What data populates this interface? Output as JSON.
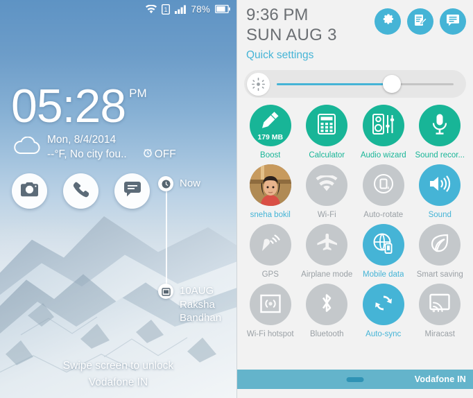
{
  "colors": {
    "accent_blue": "#45b4d6",
    "accent_green": "#18b597",
    "label_off": "#9aa0a5",
    "panel_bg": "#f2f2f2",
    "footer_bar": "#64b4cb",
    "header_text": "#6b6f73"
  },
  "lockscreen": {
    "statusbar": {
      "wifi_icon": "wifi-icon",
      "sim_icon": "sim1-icon",
      "signal_icon": "signal-bars-icon",
      "battery_percent": "78%",
      "battery_icon": "battery-icon"
    },
    "clock": {
      "time": "05:28",
      "ampm": "PM",
      "date": "Mon, 8/4/2014",
      "weather": "--°F, No city fou..",
      "alarm_status": "OFF",
      "weather_icon": "cloud-icon",
      "alarm_icon": "alarm-clock-icon"
    },
    "shortcuts": [
      {
        "name": "camera-shortcut",
        "icon": "camera-icon"
      },
      {
        "name": "phone-shortcut",
        "icon": "phone-icon"
      },
      {
        "name": "messaging-shortcut",
        "icon": "message-icon"
      }
    ],
    "timeline": [
      {
        "icon": "clock-icon",
        "label": "Now",
        "sub": ""
      },
      {
        "icon": "calendar-icon",
        "label": "10AUG",
        "sub": "Raksha\nBandhan",
        "sub_line1": "Raksha",
        "sub_line2": "Bandhan"
      }
    ],
    "unlock_hint": "Swipe screen to unlock",
    "carrier": "Vodafone IN"
  },
  "quicksettings": {
    "time": "9:36 PM",
    "date": "SUN AUG 3",
    "subtitle": "Quick settings",
    "header_buttons": [
      {
        "name": "settings-button",
        "icon": "gear-icon"
      },
      {
        "name": "edit-quick-settings-button",
        "icon": "edit-note-icon"
      },
      {
        "name": "notifications-button",
        "icon": "list-icon"
      }
    ],
    "brightness": {
      "icon": "brightness-sun-icon",
      "value_percent": 65
    },
    "tiles": [
      {
        "label": "Boost",
        "icon": "broom-icon",
        "state": "app",
        "badge": "179 MB"
      },
      {
        "label": "Calculator",
        "icon": "calculator-icon",
        "state": "app",
        "badge": ""
      },
      {
        "label": "Audio wizard",
        "icon": "audio-wizard-icon",
        "state": "app",
        "badge": ""
      },
      {
        "label": "Sound recor...",
        "icon": "microphone-icon",
        "state": "app",
        "badge": ""
      },
      {
        "label": "sneha bokil",
        "icon": "user-avatar",
        "state": "user",
        "badge": ""
      },
      {
        "label": "Wi-Fi",
        "icon": "wifi-icon",
        "state": "off",
        "badge": ""
      },
      {
        "label": "Auto-rotate",
        "icon": "auto-rotate-icon",
        "state": "off",
        "badge": ""
      },
      {
        "label": "Sound",
        "icon": "speaker-icon",
        "state": "on",
        "badge": ""
      },
      {
        "label": "GPS",
        "icon": "gps-icon",
        "state": "off",
        "badge": ""
      },
      {
        "label": "Airplane mode",
        "icon": "airplane-icon",
        "state": "off",
        "badge": ""
      },
      {
        "label": "Mobile data",
        "icon": "mobile-data-icon",
        "state": "on",
        "badge": ""
      },
      {
        "label": "Smart saving",
        "icon": "leaf-icon",
        "state": "off",
        "badge": ""
      },
      {
        "label": "Wi-Fi hotspot",
        "icon": "hotspot-icon",
        "state": "off",
        "badge": ""
      },
      {
        "label": "Bluetooth",
        "icon": "bluetooth-icon",
        "state": "off",
        "badge": ""
      },
      {
        "label": "Auto-sync",
        "icon": "sync-icon",
        "state": "on",
        "badge": ""
      },
      {
        "label": "Miracast",
        "icon": "miracast-icon",
        "state": "off",
        "badge": ""
      }
    ],
    "footer": {
      "drag_handle": "drag-handle",
      "carrier": "Vodafone IN"
    }
  }
}
